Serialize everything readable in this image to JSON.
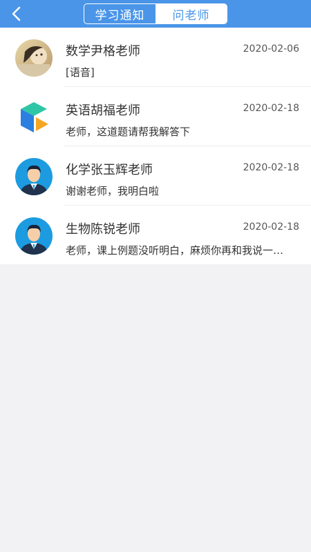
{
  "header": {
    "back_icon": "chevron-left-icon",
    "tabs": [
      {
        "label": "学习通知",
        "active": false
      },
      {
        "label": "问老师",
        "active": true
      }
    ],
    "colors": {
      "primary": "#4a95e8",
      "active_tab_bg": "#ffffff"
    }
  },
  "conversations": [
    {
      "name": "数学尹格老师",
      "date": "2020-02-06",
      "message": "[语音]",
      "avatar": "photo-avatar"
    },
    {
      "name": "英语胡福老师",
      "date": "2020-02-18",
      "message": "老师，这道题请帮我解答下",
      "avatar": "cube-logo-avatar"
    },
    {
      "name": "化学张玉辉老师",
      "date": "2020-02-18",
      "message": "谢谢老师，我明白啦",
      "avatar": "default-person-avatar"
    },
    {
      "name": "生物陈锐老师",
      "date": "2020-02-18",
      "message": "老师，课上例题没听明白，麻烦你再和我说一…",
      "avatar": "default-person-avatar"
    }
  ]
}
